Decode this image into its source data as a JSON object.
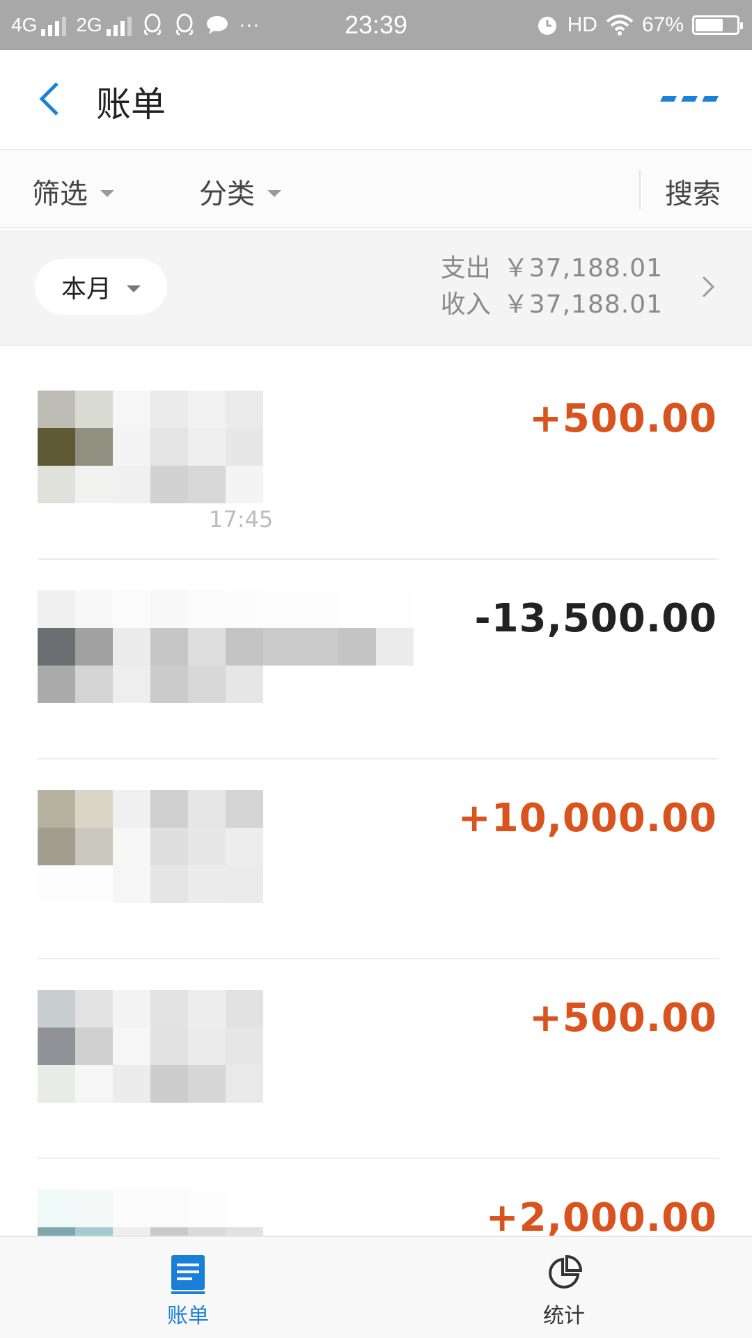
{
  "status_bar": {
    "network1": "4G",
    "network2": "2G",
    "more": "···",
    "time": "23:39",
    "hd": "HD",
    "battery_percent": "67%",
    "battery_level": 0.67
  },
  "header": {
    "title": "账单",
    "back_icon": "chevron-left-icon",
    "more_icon": "more-dots-icon",
    "accent_color": "#1a82d8"
  },
  "filters": {
    "filter_label": "筛选",
    "category_label": "分类",
    "search_label": "搜索"
  },
  "summary": {
    "period": "本月",
    "expense_label": "支出",
    "expense_value": "￥37,188.01",
    "income_label": "收入",
    "income_value": "￥37,188.01"
  },
  "transactions": [
    {
      "amount": "+500.00",
      "type": "income",
      "time": "17:45"
    },
    {
      "amount": "-13,500.00",
      "type": "expense",
      "time": ""
    },
    {
      "amount": "+10,000.00",
      "type": "income",
      "time": ""
    },
    {
      "amount": "+500.00",
      "type": "income",
      "time": ""
    },
    {
      "amount": "+2,000.00",
      "type": "income",
      "time": ""
    }
  ],
  "tabs": {
    "bills": {
      "label": "账单",
      "icon": "bill-list-icon",
      "active": true
    },
    "stats": {
      "label": "统计",
      "icon": "pie-chart-icon",
      "active": false
    }
  },
  "colors": {
    "income": "#d9531e",
    "expense": "#222222",
    "active_tab": "#1a7fd8"
  }
}
